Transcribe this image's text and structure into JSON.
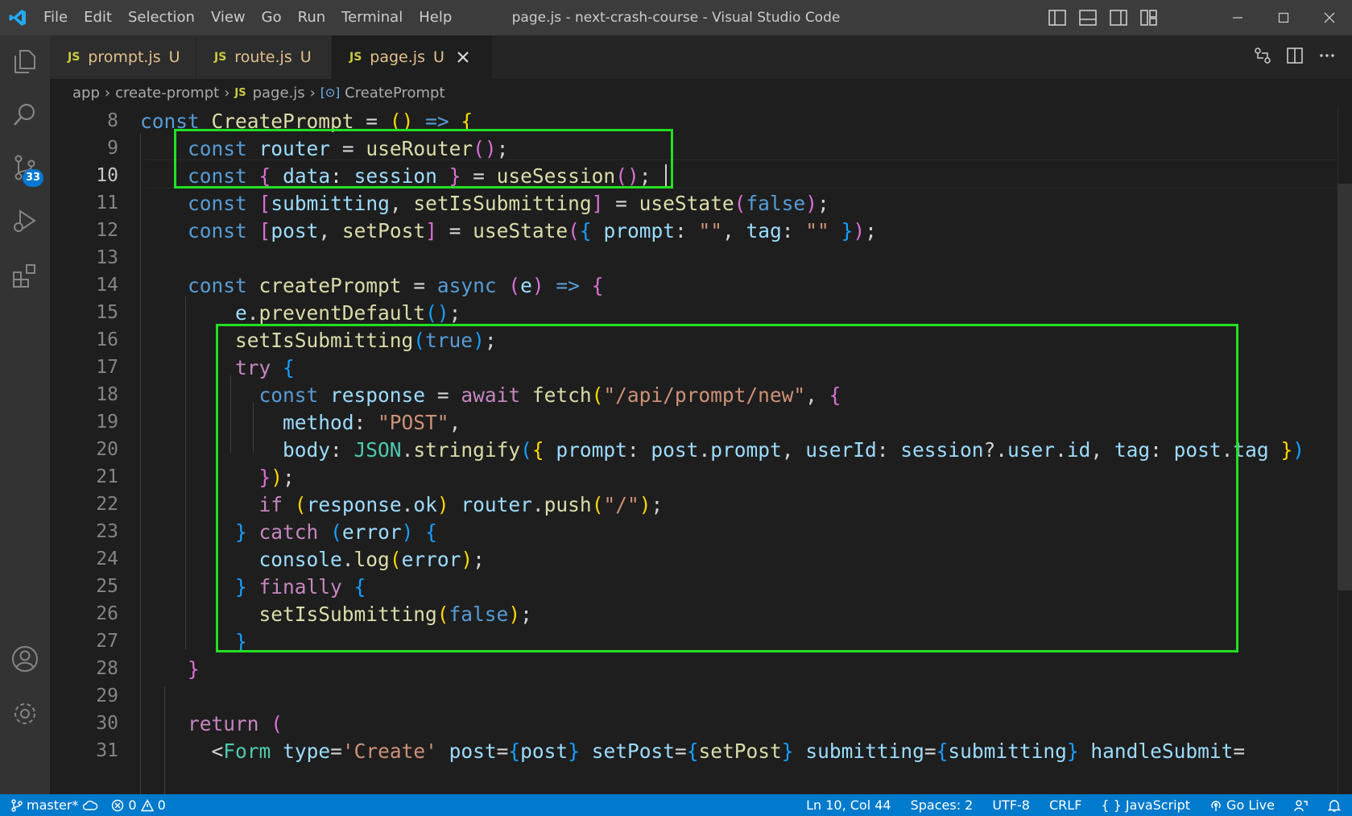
{
  "titlebar": {
    "menu": [
      "File",
      "Edit",
      "Selection",
      "View",
      "Go",
      "Run",
      "Terminal",
      "Help"
    ],
    "window_title": "page.js - next-crash-course - Visual Studio Code"
  },
  "activitybar": {
    "items": [
      "explorer-icon",
      "search-icon",
      "source-control-icon",
      "run-debug-icon",
      "extensions-icon"
    ],
    "source_control_badge": "33",
    "bottom": [
      "account-icon",
      "settings-gear-icon"
    ]
  },
  "tabs": [
    {
      "icon": "JS",
      "name": "prompt.js",
      "status": "U",
      "active": false
    },
    {
      "icon": "JS",
      "name": "route.js",
      "status": "U",
      "active": false
    },
    {
      "icon": "JS",
      "name": "page.js",
      "status": "U",
      "active": true
    }
  ],
  "breadcrumb": {
    "items": [
      "app",
      "create-prompt"
    ],
    "file_icon": "JS",
    "file": "page.js",
    "symbol": "CreatePrompt"
  },
  "editor": {
    "current_line": 10,
    "lines": [
      {
        "n": "8"
      },
      {
        "n": "9"
      },
      {
        "n": "10"
      },
      {
        "n": "11"
      },
      {
        "n": "12"
      },
      {
        "n": "13"
      },
      {
        "n": "14"
      },
      {
        "n": "15"
      },
      {
        "n": "16"
      },
      {
        "n": "17"
      },
      {
        "n": "18"
      },
      {
        "n": "19"
      },
      {
        "n": "20"
      },
      {
        "n": "21"
      },
      {
        "n": "22"
      },
      {
        "n": "23"
      },
      {
        "n": "24"
      },
      {
        "n": "25"
      },
      {
        "n": "26"
      },
      {
        "n": "27"
      },
      {
        "n": "28"
      },
      {
        "n": "29"
      },
      {
        "n": "30"
      },
      {
        "n": "31"
      }
    ],
    "highlight_color": "#22e022"
  },
  "statusbar": {
    "branch": "master*",
    "errors": "0",
    "warnings": "0",
    "position": "Ln 10, Col 44",
    "spaces": "Spaces: 2",
    "encoding": "UTF-8",
    "eol": "CRLF",
    "language": "JavaScript",
    "go_live": "Go Live"
  }
}
